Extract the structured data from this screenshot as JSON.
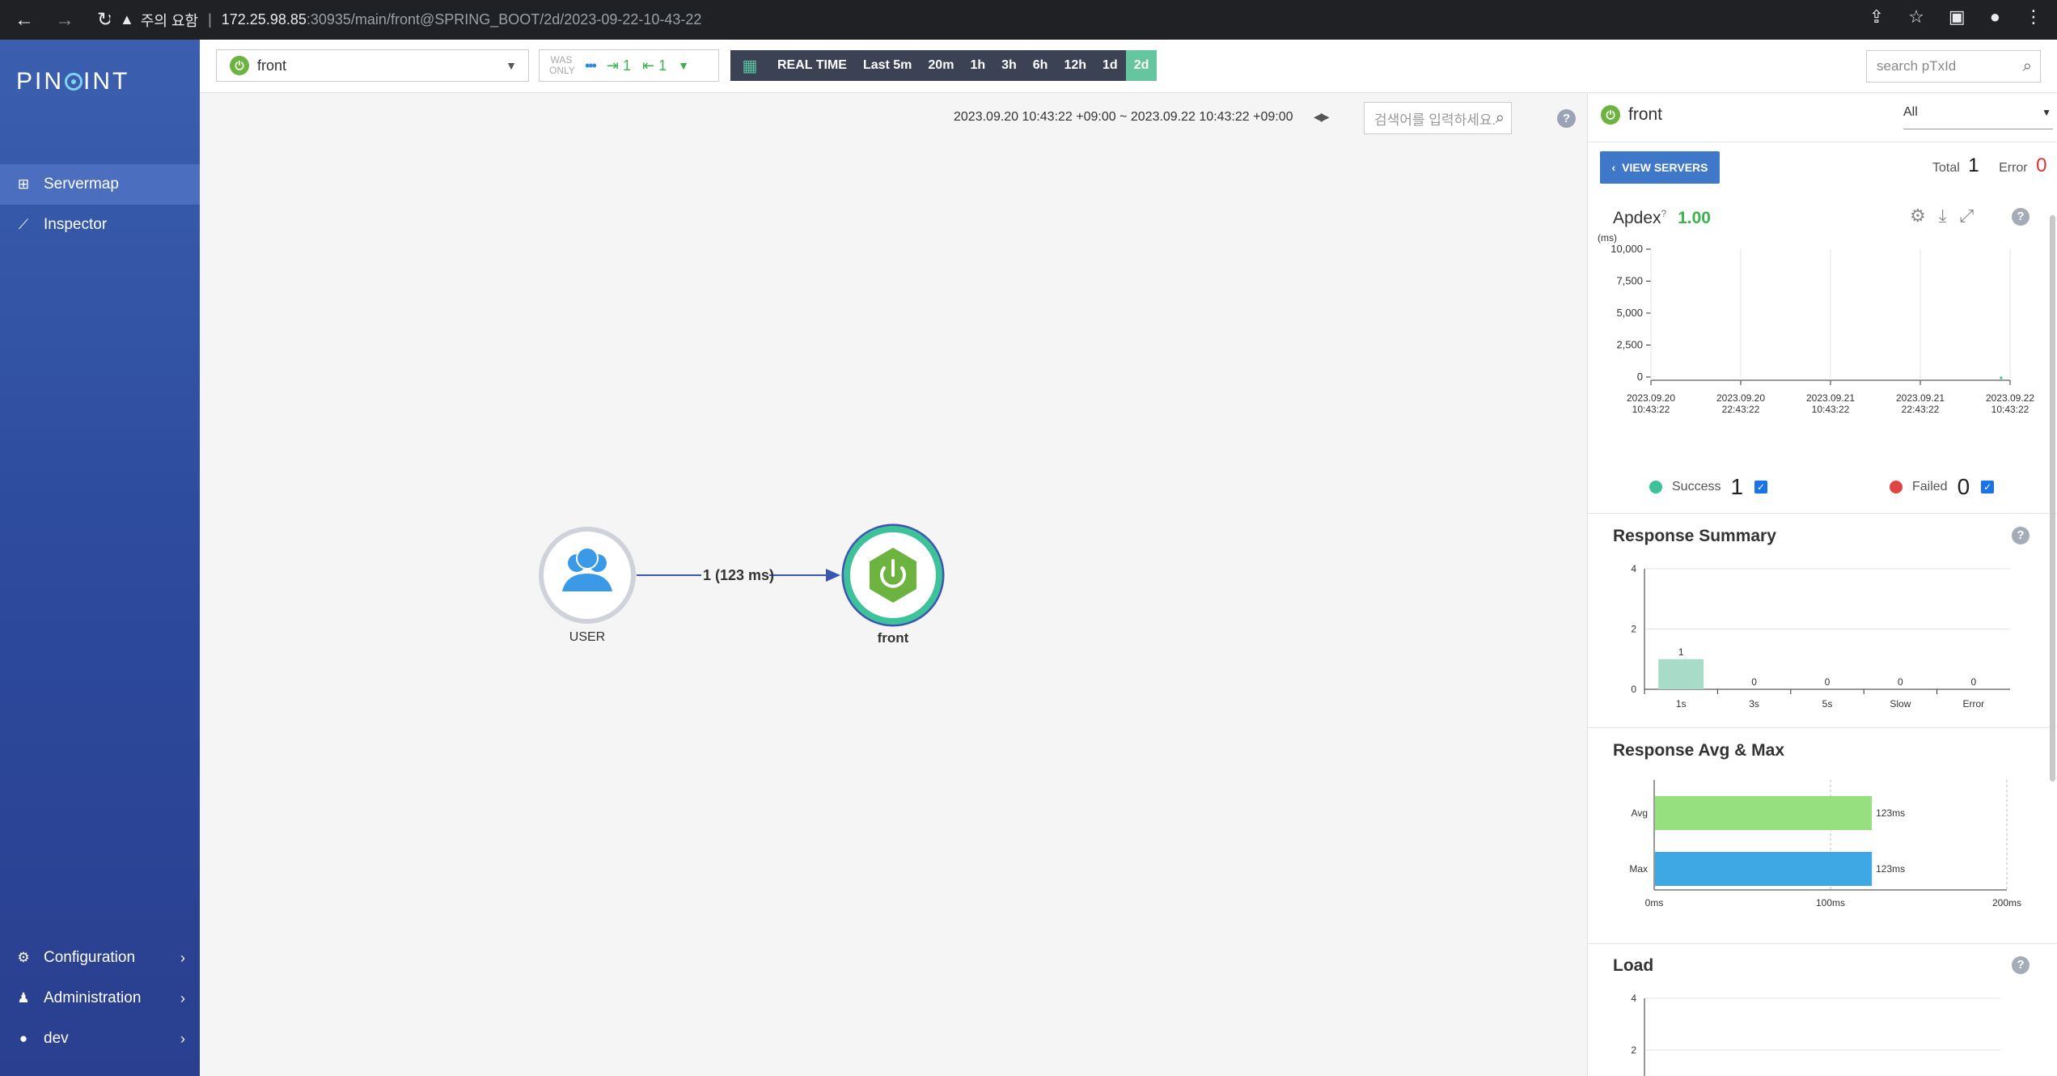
{
  "browser": {
    "security_label": "주의 요함",
    "url_host": "172.25.98.85",
    "url_path": ":30935/main/front@SPRING_BOOT/2d/2023-09-22-10-43-22"
  },
  "sidebar": {
    "logo": "PINPOINT",
    "items": [
      {
        "label": "Servermap",
        "icon": "servermap-icon"
      },
      {
        "label": "Inspector",
        "icon": "chart-icon"
      },
      {
        "label": "Configuration",
        "icon": "gear-icon"
      },
      {
        "label": "Administration",
        "icon": "user-admin-icon"
      },
      {
        "label": "dev",
        "icon": "user-icon"
      }
    ]
  },
  "topbar": {
    "app_name": "front",
    "was_only": "WAS ONLY",
    "inbound_count": "1",
    "outbound_count": "1",
    "ranges": [
      "REAL TIME",
      "Last 5m",
      "20m",
      "1h",
      "3h",
      "6h",
      "12h",
      "1d",
      "2d"
    ],
    "active_range": "2d",
    "ptxid_placeholder": "search pTxId"
  },
  "map": {
    "date_range": "2023.09.20 10:43:22 +09:00 ~ 2023.09.22 10:43:22 +09:00",
    "search_placeholder": "검색어를 입력하세요.",
    "user_label": "USER",
    "app_label": "front",
    "edge_label": "1 (123 ms)"
  },
  "panel": {
    "app_name": "front",
    "filter_value": "All",
    "view_servers_label": "VIEW SERVERS",
    "total_label": "Total",
    "total_value": "1",
    "error_label": "Error",
    "error_value": "0",
    "apdex_label": "Apdex",
    "apdex_value": "1.00",
    "success_label": "Success",
    "success_value": "1",
    "failed_label": "Failed",
    "failed_value": "0",
    "response_summary_title": "Response Summary",
    "response_avgmax_title": "Response Avg & Max",
    "load_title": "Load",
    "colors": {
      "success": "#3ec29a",
      "failed": "#e04545",
      "avg": "#97e080",
      "max": "#3ea8e5",
      "summary_bar": "#a8dcc8"
    }
  },
  "chart_data": [
    {
      "type": "scatter",
      "title": "Apdex",
      "ylabel": "(ms)",
      "yticks": [
        "10,000",
        "7,500",
        "5,000",
        "2,500",
        "0"
      ],
      "ylim": [
        0,
        10000
      ],
      "xticks": [
        [
          "2023.09.20",
          "10:43:22"
        ],
        [
          "2023.09.20",
          "22:43:22"
        ],
        [
          "2023.09.21",
          "10:43:22"
        ],
        [
          "2023.09.21",
          "22:43:22"
        ],
        [
          "2023.09.22",
          "10:43:22"
        ]
      ],
      "points": [
        {
          "x": "2023.09.22 10:30",
          "y": 123
        }
      ]
    },
    {
      "type": "bar",
      "title": "Response Summary",
      "categories": [
        "1s",
        "3s",
        "5s",
        "Slow",
        "Error"
      ],
      "values": [
        1,
        0,
        0,
        0,
        0
      ],
      "yticks": [
        "4",
        "2",
        "0"
      ],
      "ylim": [
        0,
        4
      ]
    },
    {
      "type": "bar",
      "title": "Response Avg & Max",
      "categories": [
        "Avg",
        "Max"
      ],
      "values": [
        123,
        123
      ],
      "value_labels": [
        "123ms",
        "123ms"
      ],
      "xticks": [
        "0ms",
        "100ms",
        "200ms"
      ],
      "xlim": [
        0,
        200
      ]
    },
    {
      "type": "bar",
      "title": "Load",
      "yticks": [
        "4",
        "2"
      ],
      "ylim": [
        0,
        4
      ]
    }
  ]
}
